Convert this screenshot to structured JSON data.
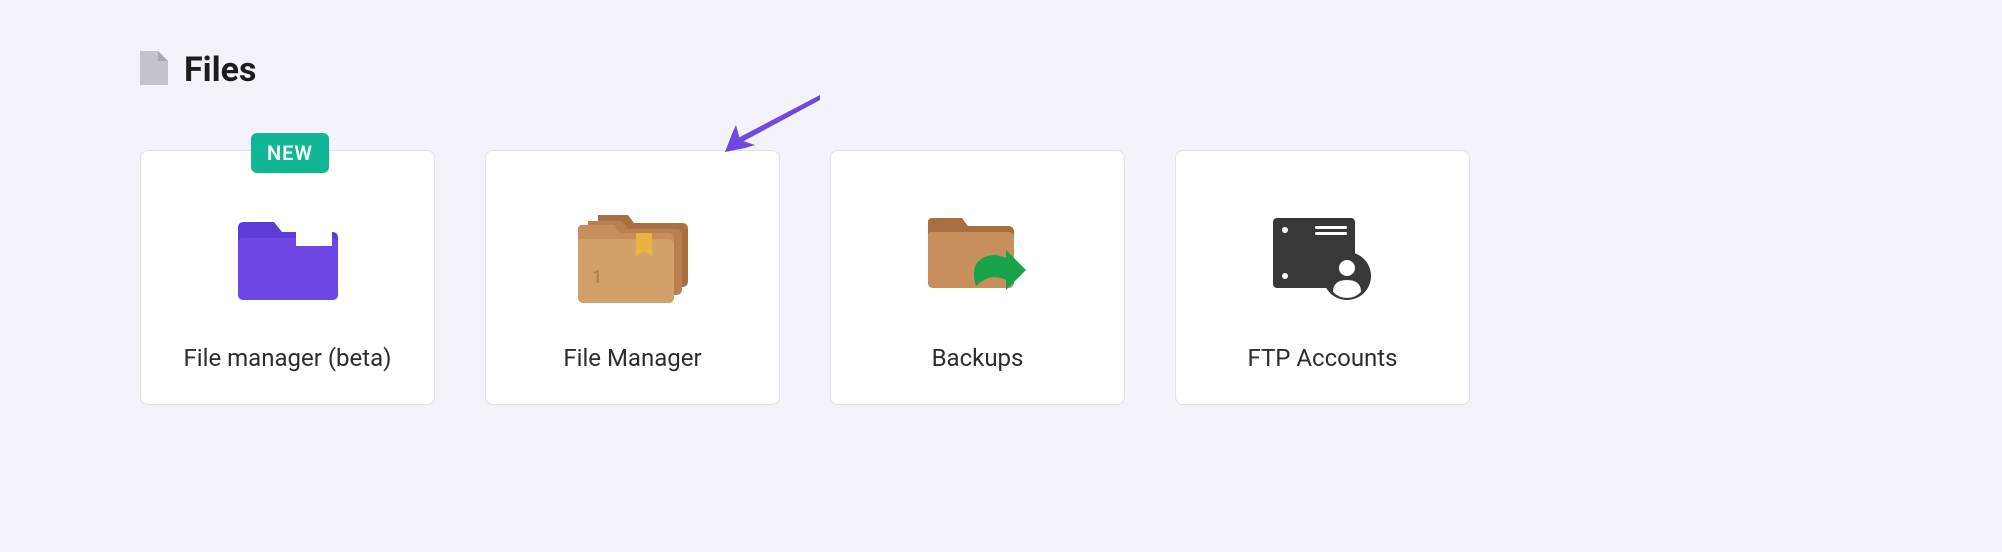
{
  "section": {
    "title": "Files"
  },
  "cards": [
    {
      "label": "File manager (beta)",
      "badge": "NEW"
    },
    {
      "label": "File Manager"
    },
    {
      "label": "Backups"
    },
    {
      "label": "FTP Accounts"
    }
  ]
}
